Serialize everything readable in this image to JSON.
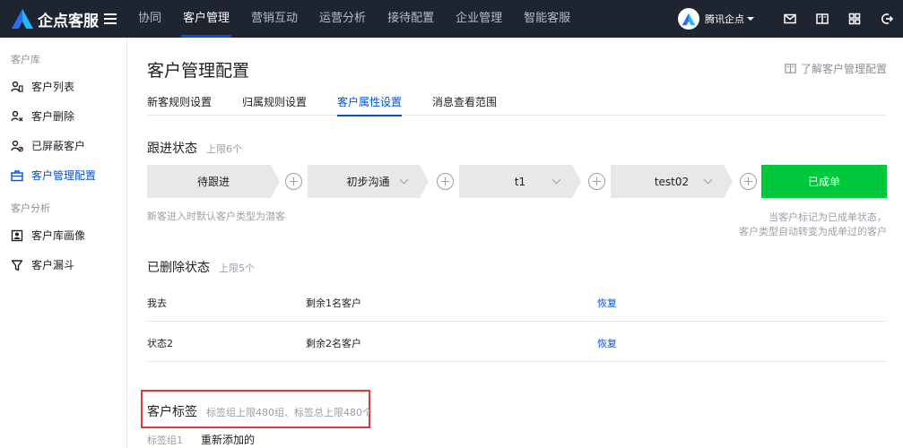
{
  "app": {
    "brand": "企点客服"
  },
  "nav": {
    "items": [
      {
        "label": "协同",
        "active": false
      },
      {
        "label": "客户管理",
        "active": true
      },
      {
        "label": "营销互动",
        "active": false
      },
      {
        "label": "运营分析",
        "active": false
      },
      {
        "label": "接待配置",
        "active": false
      },
      {
        "label": "企业管理",
        "active": false
      },
      {
        "label": "智能客服",
        "active": false
      }
    ]
  },
  "account": {
    "name": "腾讯企点"
  },
  "sidebar": {
    "groups": [
      {
        "title": "客户库",
        "items": [
          {
            "label": "客户列表",
            "icon": "customer-list-icon"
          },
          {
            "label": "客户删除",
            "icon": "user-remove-icon"
          },
          {
            "label": "已屏蔽客户",
            "icon": "user-blocked-icon"
          },
          {
            "label": "客户管理配置",
            "icon": "briefcase-icon",
            "active": true
          }
        ]
      },
      {
        "title": "客户分析",
        "items": [
          {
            "label": "客户库画像",
            "icon": "portrait-icon"
          },
          {
            "label": "客户漏斗",
            "icon": "funnel-icon"
          }
        ]
      }
    ]
  },
  "page": {
    "title": "客户管理配置",
    "help_link": "了解客户管理配置"
  },
  "tabs": [
    {
      "label": "新客规则设置",
      "active": false
    },
    {
      "label": "归属规则设置",
      "active": false
    },
    {
      "label": "客户属性设置",
      "active": true
    },
    {
      "label": "消息查看范围",
      "active": false
    }
  ],
  "follow_status": {
    "title": "跟进状态",
    "limit": "上限6个",
    "stages": [
      "待跟进",
      "初步沟通",
      "t1",
      "test02"
    ],
    "final_stage": "已成单",
    "note_left": "新客进入时默认客户类型为潜客",
    "note_right_line1": "当客户标记为已成单状态，",
    "note_right_line2": "客户类型自动转变为成单过的客户"
  },
  "deleted_status": {
    "title": "已删除状态",
    "limit": "上限5个",
    "rows": [
      {
        "name": "我去",
        "count": "剩余1名客户",
        "action": "恢复"
      },
      {
        "name": "状态2",
        "count": "剩余2名客户",
        "action": "恢复"
      }
    ]
  },
  "customer_tags": {
    "title": "客户标签",
    "limit": "标签组上限480组、标签总上限480个",
    "group_label": "标签组1",
    "group_value": "重新添加的"
  },
  "colors": {
    "topbar": "#1f2530",
    "accent": "#0052d9",
    "won": "#00c83c",
    "highlight": "#e03a3a"
  }
}
